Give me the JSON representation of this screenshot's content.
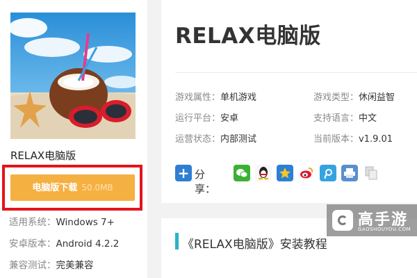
{
  "left": {
    "game_title": "RELAX电脑版",
    "download_label": "电脑版下载",
    "download_size": "50.0MB",
    "specs": [
      {
        "key": "适用系统：",
        "value": "Windows 7+"
      },
      {
        "key": "安卓版本：",
        "value": "Android 4.2.2"
      },
      {
        "key": "兼容测试：",
        "value": "完美兼容"
      }
    ]
  },
  "right": {
    "title": "RELAX电脑版",
    "attributes": [
      {
        "key": "游戏属性：",
        "value": "单机游戏"
      },
      {
        "key": "游戏类型：",
        "value": "休闲益智"
      },
      {
        "key": "运行平台：",
        "value": "安卓"
      },
      {
        "key": "支持语言：",
        "value": "中文"
      },
      {
        "key": "运营状态：",
        "value": "内部测试"
      },
      {
        "key": "当前版本：",
        "value": "v1.9.01"
      }
    ],
    "share_label": "分享："
  },
  "section": {
    "title": "《RELAX电脑版》安装教程"
  },
  "logo": {
    "name": "高手游",
    "domain": "GAOSHOUYOU.COM"
  },
  "icons": {
    "share_icons": [
      "plus-share-icon",
      "wechat-icon",
      "qq-icon",
      "qzone-icon",
      "weibo-icon",
      "tencent-weibo-icon",
      "print-icon",
      "copy-icon"
    ]
  },
  "colors": {
    "download_button": "#f5b042",
    "highlight_frame": "#e3141b",
    "section_accent": "#2bb3c7"
  }
}
